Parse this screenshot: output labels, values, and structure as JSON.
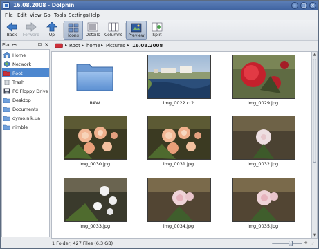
{
  "window": {
    "title": "16.08.2008 - Dolphin"
  },
  "menubar": [
    "File",
    "Edit",
    "View",
    "Go",
    "Tools",
    "Settings",
    "Help"
  ],
  "toolbar": {
    "back": "Back",
    "forward": "Forward",
    "up": "Up",
    "icons": "Icons",
    "details": "Details",
    "columns": "Columns",
    "preview": "Preview",
    "split": "Split"
  },
  "places": {
    "title": "Places",
    "items": [
      "Home",
      "Network",
      "Root",
      "Trash",
      "PC Floppy Drive",
      "Desktop",
      "Documents",
      "dymo.nik.ua",
      "nimble"
    ],
    "selected": "Root"
  },
  "breadcrumb": [
    "Root",
    "home",
    "Pictures",
    "16.08.2008"
  ],
  "files": [
    {
      "name": "RAW",
      "kind": "folder"
    },
    {
      "name": "img_0022.cr2",
      "kind": "image",
      "icon": "lake-photo-icon"
    },
    {
      "name": "img_0029.jpg",
      "kind": "image",
      "icon": "red-flower-photo-icon"
    },
    {
      "name": "img_0030.jpg",
      "kind": "image",
      "icon": "peach-roses-photo-icon"
    },
    {
      "name": "img_0031.jpg",
      "kind": "image",
      "icon": "peach-roses-photo-icon"
    },
    {
      "name": "img_0032.jpg",
      "kind": "image",
      "icon": "pale-flower-photo-icon"
    },
    {
      "name": "img_0033.jpg",
      "kind": "image",
      "icon": "white-flowers-photo-icon"
    },
    {
      "name": "img_0034.jpg",
      "kind": "image",
      "icon": "pink-flower-photo-icon"
    },
    {
      "name": "img_0035.jpg",
      "kind": "image",
      "icon": "pink-flower-photo-icon"
    }
  ],
  "status": {
    "text": "1 Folder, 427 Files (6.3 GB)"
  },
  "colors": {
    "selection": "#4d87cf",
    "titlebar": "#4a6fa9"
  }
}
